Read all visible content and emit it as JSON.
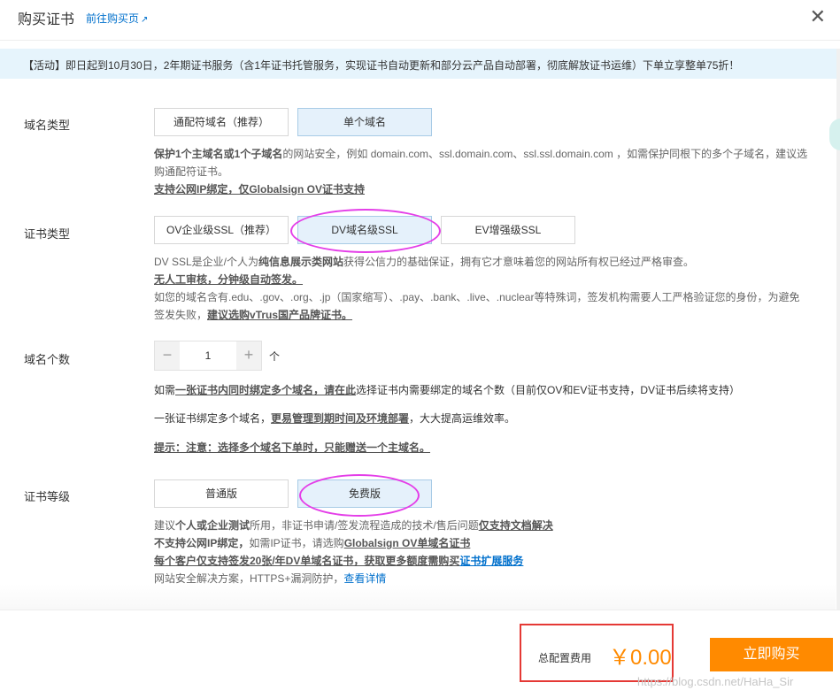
{
  "header": {
    "title": "购买证书",
    "link": "前往购买页",
    "link_icon": "↗"
  },
  "banner": {
    "text": "【活动】即日起到10月30日，2年期证书服务（含1年证书托管服务，实现证书自动更新和部分云产品自动部署，彻底解放证书运维）下单立享整单75折！"
  },
  "domain_type": {
    "label": "域名类型",
    "options": [
      "通配符域名（推荐）",
      "单个域名"
    ],
    "selected": "单个域名",
    "desc1_bold": "保护1个主域名或1个子域名",
    "desc1_rest": "的网站安全，例如 domain.com、ssl.domain.com、ssl.ssl.domain.com ，如需保护同根下的多个子域名，建议选购通配符证书。",
    "desc2": "支持公网IP绑定，仅Globalsign OV证书支持"
  },
  "cert_type": {
    "label": "证书类型",
    "options": [
      "OV企业级SSL（推荐）",
      "DV域名级SSL",
      "EV增强级SSL"
    ],
    "selected": "DV域名级SSL",
    "desc1_a": "DV SSL是企业/个人为",
    "desc1_bold": "纯信息展示类网站",
    "desc1_b": "获得公信力的基础保证，拥有它才意味着您的网站所有权已经过严格审查。",
    "desc2": "无人工审核，分钟级自动签发。",
    "desc3": "如您的域名含有.edu、.gov、.org、.jp（国家缩写）、.pay、.bank、.live、.nuclear等特殊词，签发机构需要人工严格验证您的身份，为避免签发失败，",
    "desc3_link": "建议选购vTrus国产品牌证书。"
  },
  "domain_count": {
    "label": "域名个数",
    "value": "1",
    "minus": "−",
    "plus": "+",
    "unit": "个",
    "desc1_a": "如需",
    "desc1_ul": "一张证书内同时绑定多个域名，请在此",
    "desc1_b": "选择证书内需要绑定的域名个数（目前仅OV和EV证书支持，DV证书后续将支持）",
    "desc2_a": "一张证书绑定多个域名，",
    "desc2_ul": "更易管理到期时间及环境部署",
    "desc2_b": "，大大提高运维效率。",
    "desc3": "提示：注意：选择多个域名下单时，只能赠送一个主域名。"
  },
  "cert_level": {
    "label": "证书等级",
    "options": [
      "普通版",
      "免费版"
    ],
    "selected": "免费版",
    "desc1_a": "建议",
    "desc1_bold": "个人或企业测试",
    "desc1_b": "所用，非证书申请/签发流程造成的技术/售后问题",
    "desc1_ul": "仅支持文档解决",
    "desc2_bold": "不支持公网IP绑定，",
    "desc2_a": "如需IP证书，请选购",
    "desc2_ul": "Globalsign OV单域名证书",
    "desc3_ul": "每个客户仅支持签发20张/年DV单域名证书，获取更多额度需购买",
    "desc3_link": "证书扩展服务",
    "desc4_a": "网站安全解决方案，HTTPS+漏洞防护，",
    "desc4_link": "查看详情"
  },
  "footer": {
    "total_label": "总配置费用",
    "total_value": "￥0.00",
    "buy_label": "立即购买",
    "watermark": "https://blog.csdn.net/HaHa_Sir"
  },
  "colors": {
    "accent_orange": "#ff8a00",
    "link_blue": "#0070cc",
    "selected_bg": "#e5f1fb",
    "banner_bg": "#e6f4fc",
    "annotation_magenta": "#e43ee8",
    "annotation_red": "#e53935"
  }
}
